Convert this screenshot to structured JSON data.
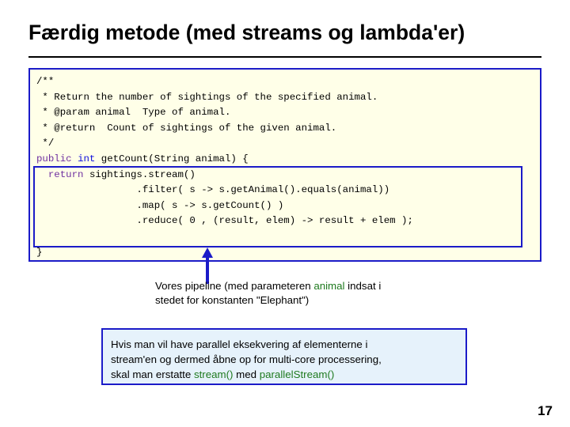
{
  "slide": {
    "title": "Færdig metode (med streams og lambda'er)",
    "page_number": "17"
  },
  "code_block": {
    "lines": [
      "/**",
      " * Return the number of sightings of the specified animal.",
      " * @param animal  Type of animal.",
      " * @return  Count of sightings of the given animal.",
      " */"
    ],
    "signature": {
      "modifier": "public",
      "return_type": "int",
      "rest": " getCount(String animal) {"
    },
    "body": {
      "return_keyword": "return",
      "line1": "sightings.stream()",
      "line2": ".filter( s -> s.getAnimal().equals(animal))",
      "line3": ".map( s -> s.getCount() )",
      "line4": ".reduce( 0 , (result, elem) -> result + elem );"
    },
    "closing_brace": "}"
  },
  "caption": {
    "part1": "Vores pipeline (med parameteren ",
    "highlight1": "animal",
    "part2": " indsat i",
    "line2": "stedet for konstanten \"Elephant\")"
  },
  "note": {
    "line1": "Hvis man vil have parallel eksekvering af elementerne i",
    "line2": "stream'en og dermed åbne op for multi-core processering,",
    "line3_pre": "skal man erstatte ",
    "line3_hl1": "stream()",
    "line3_mid": " med ",
    "line3_hl2": "parallelStream()"
  },
  "colors": {
    "code_border": "#1b1bc8",
    "code_background": "#ffffe8",
    "note_background": "#e6f2fb",
    "keyword_purple": "#7030a0",
    "keyword_blue": "#0c0cdc",
    "highlight_green": "#1f7a1f"
  }
}
